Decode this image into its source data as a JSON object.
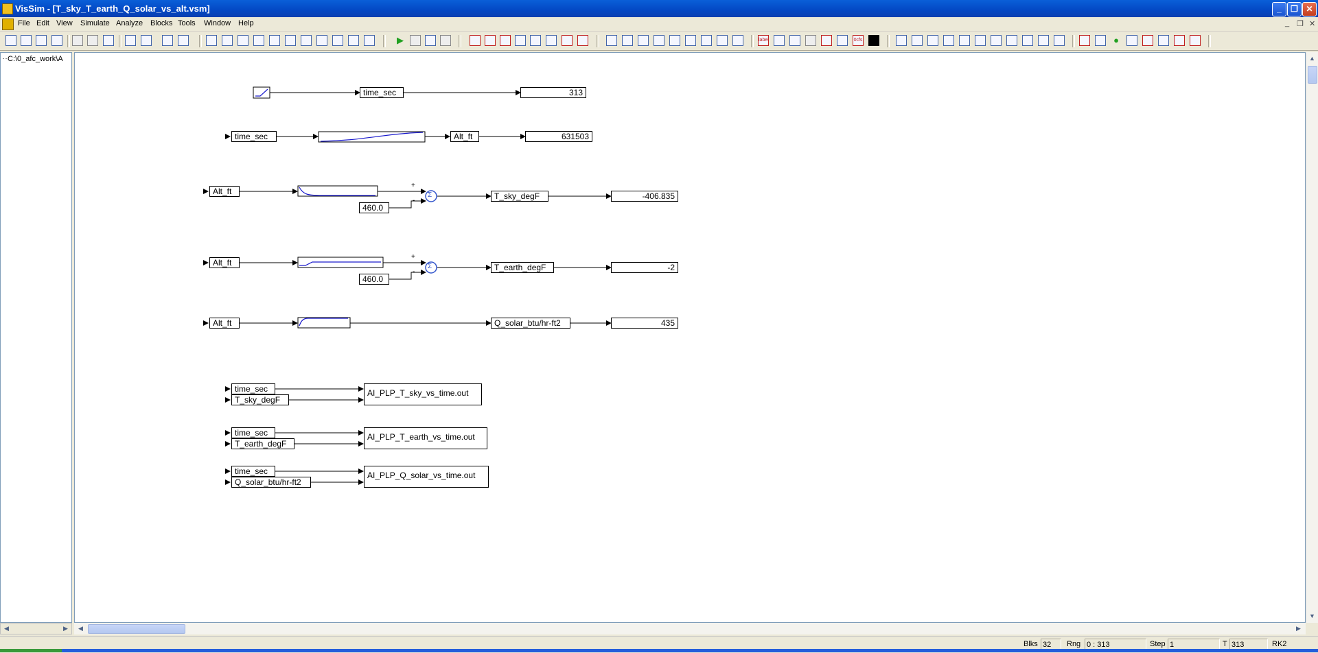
{
  "window": {
    "title": "VisSim - [T_sky_T_earth_Q_solar_vs_alt.vsm]",
    "minimize_glyph": "_",
    "maximize_glyph": "❐",
    "close_glyph": "✕"
  },
  "menu": {
    "items": [
      "File",
      "Edit",
      "View",
      "Simulate",
      "Analyze",
      "Blocks",
      "Tools",
      "Window",
      "Help"
    ],
    "mdi_minimize": "_",
    "mdi_restore": "❐",
    "mdi_close": "✕"
  },
  "toolbar": {
    "file_icons": [
      "new-file-icon",
      "open-folder-icon",
      "save-icon",
      "print-icon"
    ],
    "edit_icons": [
      "cut-icon",
      "copy-icon",
      "paste-icon"
    ],
    "simulate_icons": [
      "play-icon",
      "pause-icon",
      "step-icon",
      "continue-icon"
    ],
    "label_button": "label",
    "ocfs_button": "0cfs"
  },
  "tree": {
    "path": "C:\\0_afc_work\\A"
  },
  "diagram": {
    "row1": {
      "in_label": "time_sec",
      "display": "313"
    },
    "row2": {
      "in_label": "time_sec",
      "out_label": "Alt_ft",
      "display": "631503"
    },
    "row3": {
      "in_label": "Alt_ft",
      "const": "460.0",
      "plus": "+",
      "minus": "-",
      "sum": "Σ",
      "out_label": "T_sky_degF",
      "display": "-406.835"
    },
    "row4": {
      "in_label": "Alt_ft",
      "const": "460.0",
      "plus": "+",
      "minus": "-",
      "sum": "Σ",
      "out_label": "T_earth_degF",
      "display": "-2"
    },
    "row5": {
      "in_label": "Alt_ft",
      "out_label": "Q_solar_btu/hr-ft2",
      "display": "435"
    },
    "export1": {
      "in1": "time_sec",
      "in2": "T_sky_degF",
      "file": "AI_PLP_T_sky_vs_time.out"
    },
    "export2": {
      "in1": "time_sec",
      "in2": "T_earth_degF",
      "file": "AI_PLP_T_earth_vs_time.out"
    },
    "export3": {
      "in1": "time_sec",
      "in2": "Q_solar_btu/hr-ft2",
      "file": "AI_PLP_Q_solar_vs_time.out"
    }
  },
  "status": {
    "blks_label": "Blks",
    "blks_value": "32",
    "rng_label": "Rng",
    "rng_value": "0 : 313",
    "step_label": "Step",
    "step_value": "1",
    "t_label": "T",
    "t_value": "313",
    "method": "RK2"
  },
  "colors": {
    "titlebar": "#0348c4",
    "block_curve": "#1a1acc",
    "sum_block": "#3355cc",
    "play": "#20a020"
  }
}
